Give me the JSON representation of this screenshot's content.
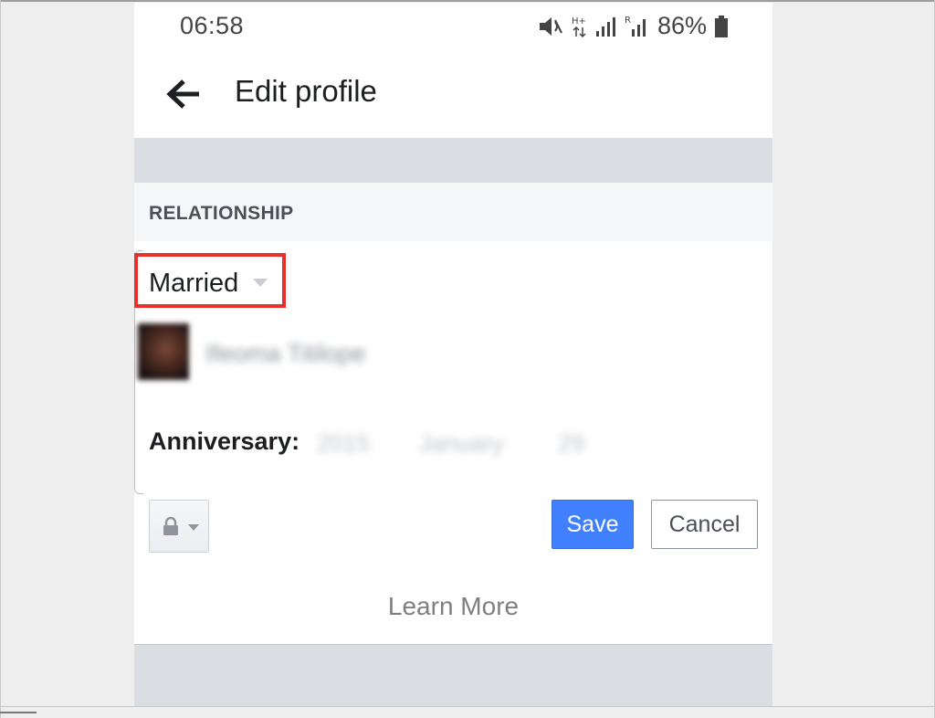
{
  "statusbar": {
    "time": "06:58",
    "network_label": "H+",
    "sim2_label": "R",
    "battery_percent": "86%",
    "icons": [
      "mute-icon",
      "network-arrows-icon",
      "signal-icon",
      "battery-icon"
    ]
  },
  "header": {
    "back_icon": "arrow-left-icon",
    "title": "Edit profile"
  },
  "section": {
    "title": "RELATIONSHIP"
  },
  "relationship": {
    "status_value": "Married",
    "partner_name": "Ifeoma Titilope",
    "anniversary_label": "Anniversary:",
    "anniversary_year": "2015",
    "anniversary_month": "January",
    "anniversary_day": "29"
  },
  "actions": {
    "privacy_icon": "lock-icon",
    "save_label": "Save",
    "cancel_label": "Cancel",
    "learn_more_label": "Learn More"
  },
  "colors": {
    "accent": "#4080ff",
    "highlight": "#e5322d",
    "band": "#dadde1"
  }
}
